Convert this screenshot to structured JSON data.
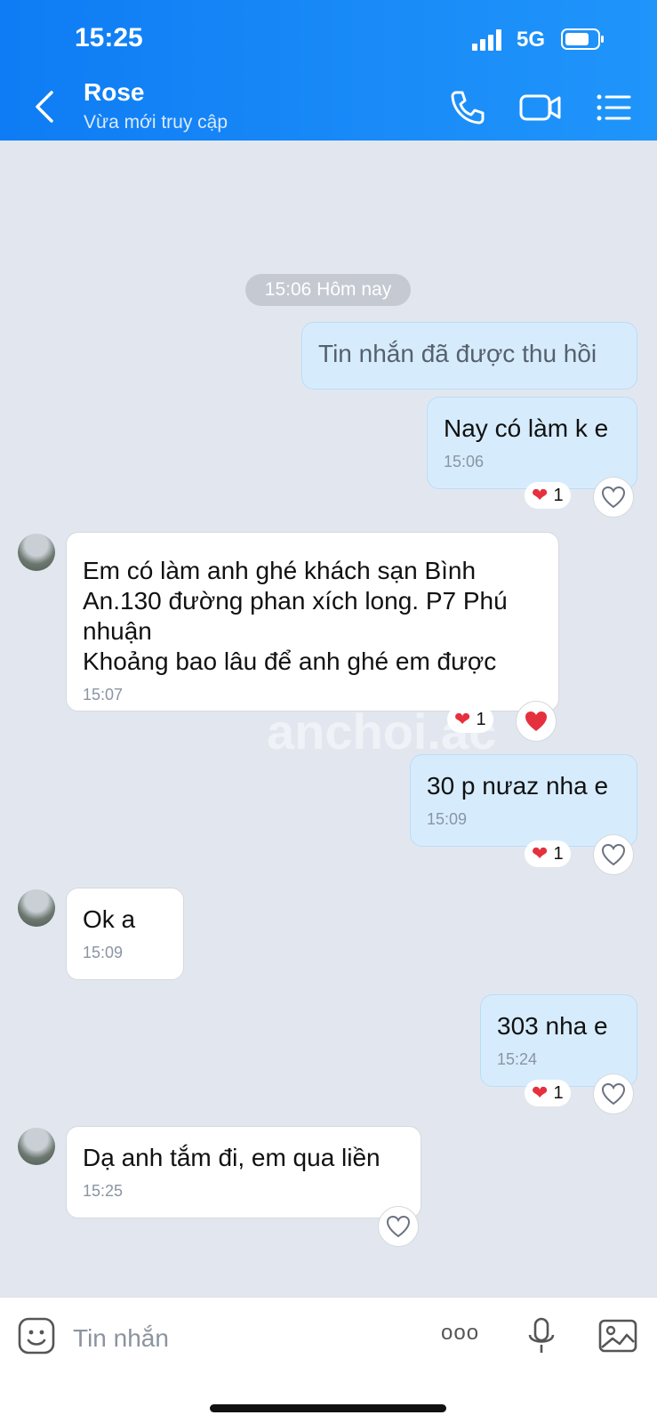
{
  "status": {
    "time": "15:25",
    "network": "5G"
  },
  "header": {
    "name": "Rose",
    "status": "Vừa mới truy cập"
  },
  "chat": {
    "date_divider": "15:06 Hôm nay",
    "messages": [
      {
        "text": "Tin nhắn đã được thu hồi"
      },
      {
        "text": "Nay có làm k e",
        "time": "15:06",
        "reaction_count": "1"
      },
      {
        "text": "Em có làm anh ghé khách sạn Bình An.130 đường phan xích long. P7 Phú nhuận\nKhoảng bao lâu để anh ghé em được",
        "time": "15:07",
        "reaction_count": "1"
      },
      {
        "text": "30 p nưaz nha e",
        "time": "15:09",
        "reaction_count": "1"
      },
      {
        "text": "Ok a",
        "time": "15:09"
      },
      {
        "text": "303 nha e",
        "time": "15:24",
        "reaction_count": "1"
      },
      {
        "text": "Dạ anh tắm đi, em qua liền",
        "time": "15:25"
      }
    ],
    "watermark": "anchoi.ac"
  },
  "input": {
    "placeholder": "Tin nhắn",
    "more_label": "ooo"
  },
  "colors": {
    "header": "#1a8bf8",
    "outgoing": "#d6ecfd",
    "incoming": "#ffffff",
    "heart": "#e5303e"
  },
  "icons": [
    "back-icon",
    "phone-icon",
    "video-icon",
    "menu-icon",
    "emoji-icon",
    "mic-icon",
    "image-icon",
    "heart-icon",
    "heart-outline-icon"
  ]
}
